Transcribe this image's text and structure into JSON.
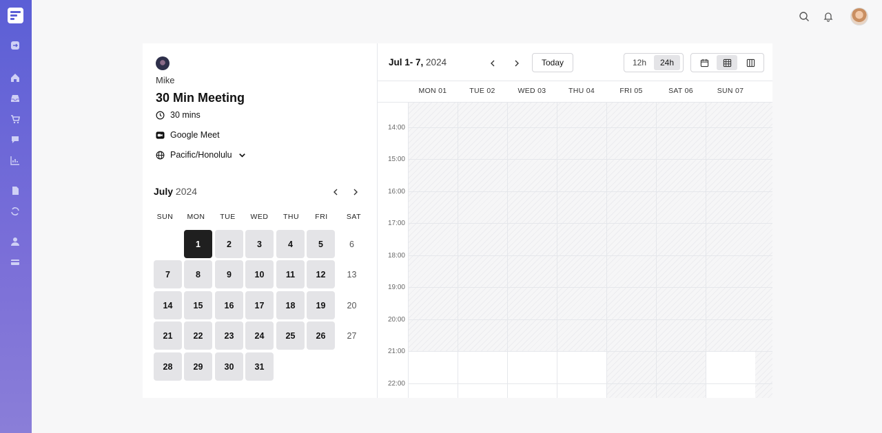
{
  "host": {
    "name": "Mike"
  },
  "event": {
    "title": "30 Min Meeting",
    "duration": "30 mins",
    "location": "Google Meet",
    "timezone": "Pacific/Honolulu"
  },
  "month": {
    "name": "July",
    "year": "2024",
    "weekdays": [
      "SUN",
      "MON",
      "TUE",
      "WED",
      "THU",
      "FRI",
      "SAT"
    ],
    "selected_day": "1"
  },
  "week": {
    "range": "Jul 1- 7,",
    "year": "2024",
    "today_label": "Today",
    "format_12h": "12h",
    "format_24h": "24h",
    "active_format": "24h",
    "days": [
      "MON  01",
      "TUE  02",
      "WED  03",
      "THU  04",
      "FRI  05",
      "SAT  06",
      "SUN  07"
    ],
    "times": [
      "14:00",
      "15:00",
      "16:00",
      "17:00",
      "18:00",
      "19:00",
      "20:00",
      "21:00",
      "22:00"
    ]
  },
  "colors": {
    "sidebar": "#5b5fd6",
    "selected_day": "#1f1f1f",
    "available_day": "#e4e4e7"
  }
}
